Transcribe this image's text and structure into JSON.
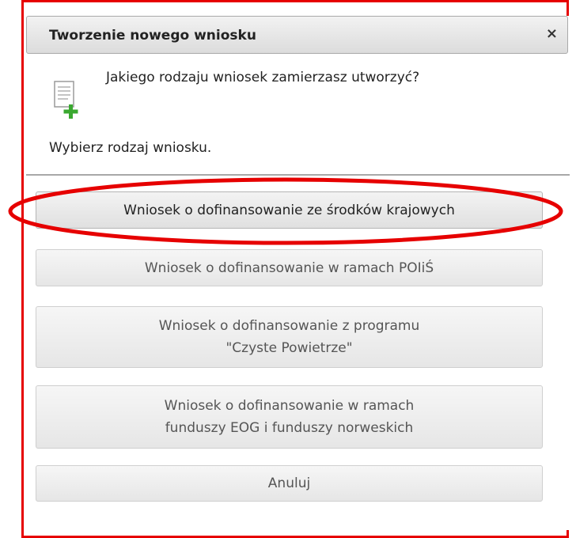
{
  "dialog": {
    "title": "Tworzenie nowego wniosku",
    "close_label": "×",
    "icon": "document-add-icon",
    "question": "Jakiego rodzaju wniosek zamierzasz utworzyć?",
    "instruction": "Wybierz rodzaj wniosku."
  },
  "options": [
    {
      "label": "Wniosek o dofinansowanie ze środków krajowych"
    },
    {
      "label": "Wniosek o dofinansowanie w ramach POIiŚ"
    },
    {
      "label": "Wniosek o dofinansowanie z programu\n\"Czyste Powietrze\""
    },
    {
      "label": "Wniosek o dofinansowanie w ramach\nfunduszy EOG i funduszy norweskich"
    }
  ],
  "cancel_label": "Anuluj",
  "colors": {
    "annotation_red": "#e60000",
    "icon_green": "#3aa830"
  }
}
